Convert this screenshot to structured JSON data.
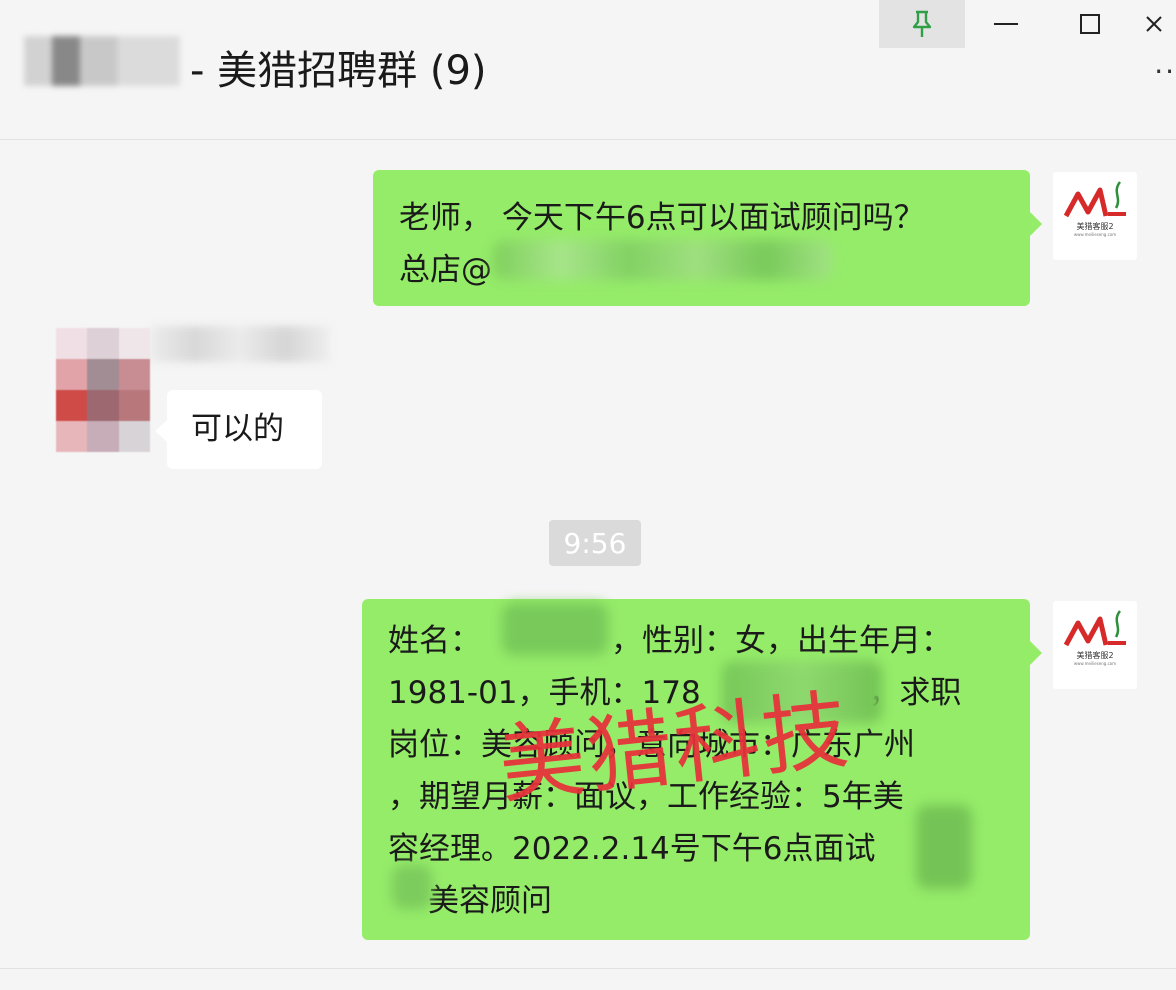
{
  "window": {
    "title": "- 美猎招聘群 (9)",
    "pin_icon": "pin-icon",
    "more_label": "··"
  },
  "messages": [
    {
      "side": "right",
      "lines": [
        "老师， 今天下午6点可以面试顾问吗？",
        "总店@"
      ]
    },
    {
      "side": "left",
      "text": "可以的"
    },
    {
      "side": "right",
      "lines": [
        "姓名：",
        "，性别：女，出生年月：",
        "1981-01，手机：178",
        "3，求职",
        "岗位：美容顾问，意向城市：广东广州",
        "，期望月薪：面议，工作经验：5年美",
        "容经理。2022.2.14号下午6点面试",
        "美容顾问"
      ]
    }
  ],
  "timestamp": "9:56",
  "avatar_logo": {
    "mark": "ML",
    "text": "美猎客服2",
    "subtext": "www.meilieseng.com"
  },
  "watermark": "美猎科技",
  "colors": {
    "bubble_green": "#95ec69",
    "background": "#f5f5f5",
    "watermark": "#e8303a"
  }
}
